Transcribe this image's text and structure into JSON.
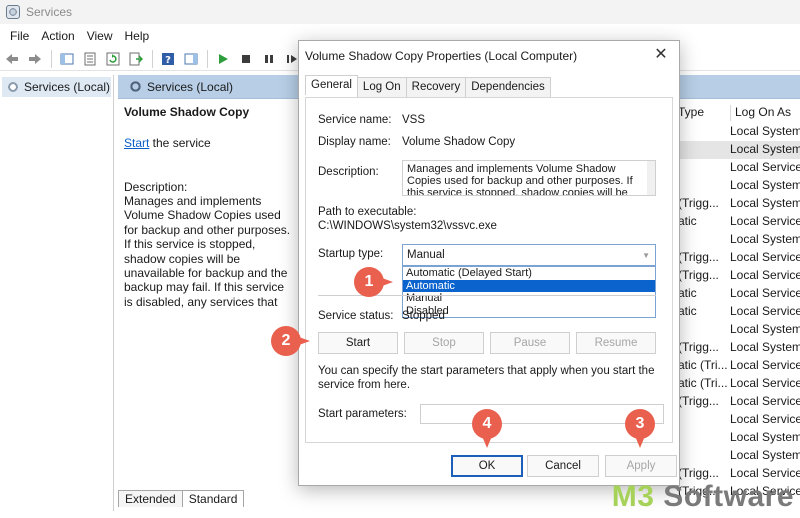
{
  "window": {
    "title": "Services"
  },
  "menu": [
    "File",
    "Action",
    "View",
    "Help"
  ],
  "toolbar": {
    "icons": [
      "back-arrow-icon",
      "forward-arrow-icon",
      "console-tree-icon",
      "properties-sheet-icon",
      "refresh-icon",
      "export-list-icon",
      "help-icon",
      "action-pane-icon",
      "play-icon",
      "stop-icon",
      "pause-icon",
      "restart-icon"
    ]
  },
  "tree": {
    "root_label": "Services (Local)"
  },
  "content": {
    "header_label": "Services (Local)",
    "service_title": "Volume Shadow Copy",
    "start_link": "Start",
    "start_suffix": " the service",
    "description_label": "Description:",
    "description_text": "Manages and implements Volume Shadow Copies used for backup and other purposes. If this service is stopped, shadow copies will be unavailable for backup and the backup may fail. If this service is disabled, any services that explicitly depend on it will fail to start."
  },
  "grid": {
    "columns": {
      "type": "Type",
      "logon": "Log On As"
    },
    "rows": [
      {
        "type": "",
        "logon": "Local System"
      },
      {
        "type": "",
        "logon": "Local System"
      },
      {
        "type": "",
        "logon": "Local Service"
      },
      {
        "type": "",
        "logon": "Local System"
      },
      {
        "type": "(Trigg...",
        "logon": "Local System"
      },
      {
        "type": "atic",
        "logon": "Local Service"
      },
      {
        "type": "",
        "logon": "Local System"
      },
      {
        "type": "(Trigg...",
        "logon": "Local Service"
      },
      {
        "type": "(Trigg...",
        "logon": "Local Service"
      },
      {
        "type": "atic",
        "logon": "Local Service"
      },
      {
        "type": "atic",
        "logon": "Local Service"
      },
      {
        "type": "",
        "logon": "Local System"
      },
      {
        "type": "(Trigg...",
        "logon": "Local System"
      },
      {
        "type": "atic (Tri...",
        "logon": "Local Service"
      },
      {
        "type": "atic (Tri...",
        "logon": "Local Service"
      },
      {
        "type": "(Trigg...",
        "logon": "Local Service"
      },
      {
        "type": "",
        "logon": "Local Service"
      },
      {
        "type": "",
        "logon": "Local System"
      },
      {
        "type": "",
        "logon": "Local System"
      },
      {
        "type": "(Trigg...",
        "logon": "Local Service"
      },
      {
        "type": "(Trigg...",
        "logon": "Local Service"
      }
    ]
  },
  "bottom_tabs": [
    "Extended",
    "Standard"
  ],
  "dialog": {
    "title": "Volume Shadow Copy Properties (Local Computer)",
    "close_glyph": "✕",
    "tabs": [
      "General",
      "Log On",
      "Recovery",
      "Dependencies"
    ],
    "service_name_label": "Service name:",
    "service_name_value": "VSS",
    "display_name_label": "Display name:",
    "display_name_value": "Volume Shadow Copy",
    "description_label": "Description:",
    "description_value": "Manages and implements Volume Shadow Copies used for backup and other purposes. If this service is stopped, shadow copies will be unavailable for backup and the backup may fail.",
    "path_label": "Path to executable:",
    "path_value": "C:\\WINDOWS\\system32\\vssvc.exe",
    "startup_type_label": "Startup type:",
    "startup_type_value": "Manual",
    "startup_options": [
      "Automatic (Delayed Start)",
      "Automatic",
      "Manual",
      "Disabled"
    ],
    "startup_highlighted": "Automatic",
    "service_status_label": "Service status:",
    "service_status_value": "Stopped",
    "buttons": {
      "start": "Start",
      "stop": "Stop",
      "pause": "Pause",
      "resume": "Resume"
    },
    "hint": "You can specify the start parameters that apply when you start the service from here.",
    "start_params_label": "Start parameters:",
    "start_params_value": "",
    "ok": "OK",
    "cancel": "Cancel",
    "apply": "Apply"
  },
  "callouts": [
    "1",
    "2",
    "3",
    "4"
  ],
  "colors": {
    "callout": "#e9604f",
    "selection": "#0b63ce",
    "header": "#b7cee6",
    "link": "#0a5ec7"
  },
  "watermark": {
    "brand_prefix": "M3",
    "brand_suffix": " Software"
  }
}
